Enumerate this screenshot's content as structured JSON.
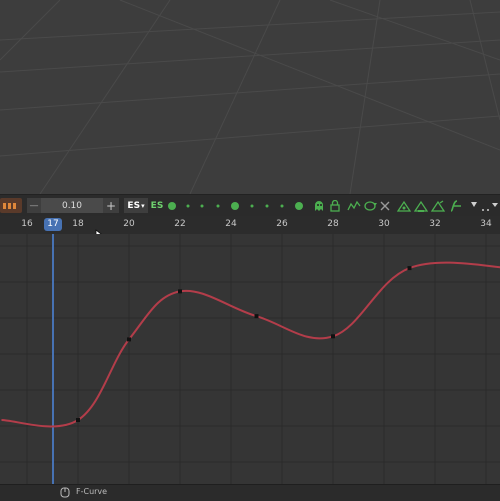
{
  "toolbar": {
    "value_field": "0.10",
    "keying_set_short": "ES",
    "keying_set_label": "ES",
    "accent_color": "#4caf50"
  },
  "ruler": {
    "frames": [
      "16",
      "18",
      "20",
      "22",
      "24",
      "26",
      "28",
      "30",
      "32",
      "34"
    ],
    "current_frame": "17"
  },
  "graph": {
    "curve_color": "#b33d4a",
    "curve_keyframes": [
      {
        "frame": 15,
        "value": 0.0
      },
      {
        "frame": 18,
        "value": 0.0
      },
      {
        "frame": 20,
        "value": 0.52
      },
      {
        "frame": 22,
        "value": 0.83
      },
      {
        "frame": 25,
        "value": 0.67
      },
      {
        "frame": 28,
        "value": 0.54
      },
      {
        "frame": 31,
        "value": 0.98
      },
      {
        "frame": 35,
        "value": 0.98
      }
    ]
  },
  "status": {
    "label": "F-Curve"
  }
}
